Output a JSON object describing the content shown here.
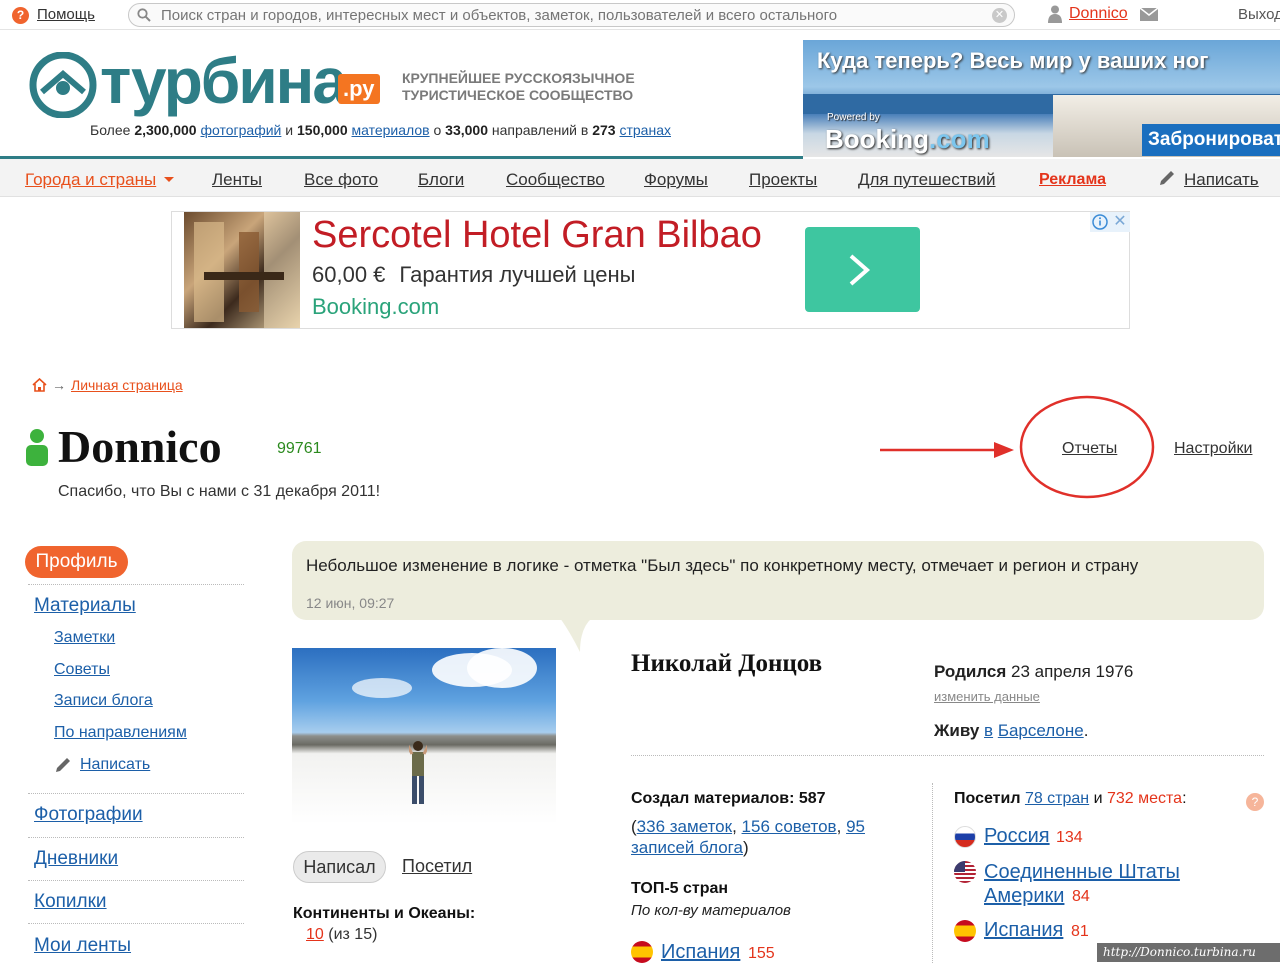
{
  "topbar": {
    "help_label": "Помощь",
    "search_placeholder": "Поиск стран и городов, интересных мест и объектов, заметок, пользователей и всего остального",
    "username": "Donnico",
    "logout_label": "Выход"
  },
  "header": {
    "logo_text": "турбина",
    "logo_tld": ".ру",
    "tagline_line1": "КРУПНЕЙШЕЕ РУССКОЯЗЫЧНОЕ",
    "tagline_line2": "ТУРИСТИЧЕСКОЕ СООБЩЕСТВО",
    "stats": {
      "prefix": "Более",
      "photos_count": "2,300,000",
      "photos_label": "фотографий",
      "and1": "и",
      "materials_count": "150,000",
      "materials_label": "материалов",
      "about": "о",
      "directions_count": "33,000",
      "directions_label": "направлений в",
      "countries_count": "273",
      "countries_label": "странах"
    }
  },
  "banner": {
    "title": "Куда теперь? Весь мир у ваших ног",
    "powered": "Powered by",
    "brand_main": "Booking",
    "brand_tld": ".com",
    "button": "Забронировать"
  },
  "nav": {
    "items": [
      "Города и страны",
      "Ленты",
      "Все фото",
      "Блоги",
      "Сообщество",
      "Форумы",
      "Проекты",
      "Для путешествий",
      "Реклама",
      "Написать"
    ]
  },
  "ad": {
    "title": "Sercotel Hotel Gran Bilbao",
    "price": "60,00 €",
    "guarantee": "Гарантия лучшей цены",
    "site": "Booking.com"
  },
  "breadcrumb": {
    "arrow": "→",
    "current": "Личная страница"
  },
  "profile": {
    "name": "Donnico",
    "score": "99761",
    "since": "Спасибо, что Вы с нами с 31 декабря 2011!",
    "reports": "Отчеты",
    "settings": "Настройки"
  },
  "sidebar": {
    "active": "Профиль",
    "materials": "Материалы",
    "sub": [
      "Заметки",
      "Советы",
      "Записи блога",
      "По направлениям",
      "Написать"
    ],
    "photos": "Фотографии",
    "diaries": "Дневники",
    "collections": "Копилки",
    "feeds": "Мои ленты"
  },
  "status": {
    "text": "Небольшое изменение в логике - отметка \"Был здесь\" по конкретному месту, отмечает и регион и страну",
    "time": "12 июн, 09:27"
  },
  "tabs": {
    "wrote": "Написал",
    "visited": "Посетил"
  },
  "continents": {
    "label": "Континенты и Океаны:",
    "count": "10",
    "total": "(из 15)"
  },
  "details": {
    "full_name": "Николай Донцов",
    "born_label": "Родился",
    "born_date": "23 апреля 1976",
    "edit": "изменить данные",
    "lives_label": "Живу",
    "lives_prefix": "в",
    "city": "Барселоне",
    "lives_end": "."
  },
  "created": {
    "label": "Создал материалов: 587",
    "notes": "336 заметок",
    "tips": "156 советов",
    "blog_count": "95",
    "blog_label": "записей блога",
    "open_paren": "(",
    "comma": ",",
    "close_paren": ")"
  },
  "top5": {
    "label": "ТОП-5 стран",
    "sub": "По кол-ву материалов",
    "items": [
      {
        "country": "Испания",
        "count": "155"
      }
    ]
  },
  "visited": {
    "label": "Посетил",
    "countries": "78 стран",
    "and": "и",
    "places": "732 места",
    "colon": ":",
    "items": [
      {
        "country": "Россия",
        "count": "134"
      },
      {
        "country": "Соединенные Штаты Америки",
        "count": "84"
      },
      {
        "country": "Испания",
        "count": "81"
      }
    ]
  },
  "watermark": "http://Donnico.turbina.ru"
}
